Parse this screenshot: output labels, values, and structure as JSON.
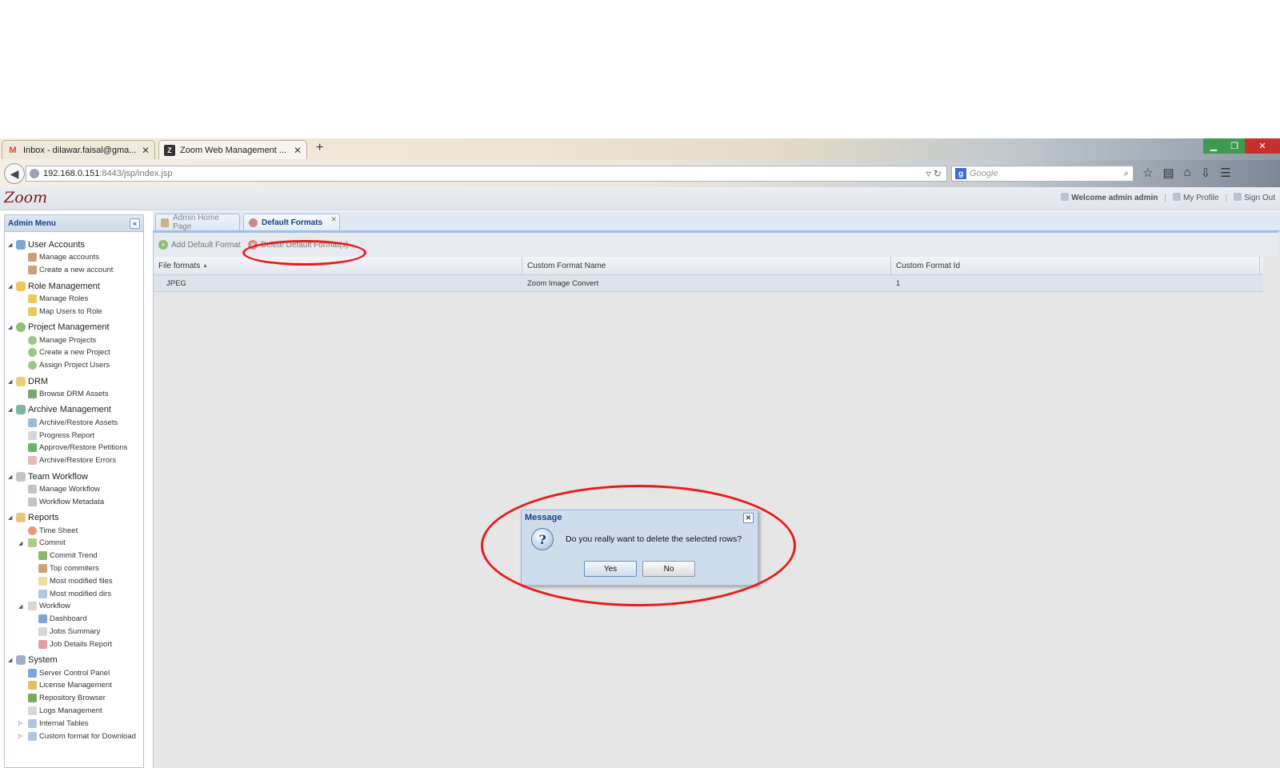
{
  "browser": {
    "tabs": [
      {
        "label": "Inbox - dilawar.faisal@gma...",
        "icon": "gmail-icon"
      },
      {
        "label": "Zoom Web Management ...",
        "icon": "zoom-icon"
      }
    ],
    "new_tab": "+",
    "url_host": "192.168.0.151",
    "url_rest": ":8443/jsp/index.jsp",
    "search_placeholder": "Google"
  },
  "app": {
    "logo": "Zoom",
    "welcome": "Welcome admin admin",
    "my_profile": "My Profile",
    "sign_out": "Sign Out"
  },
  "sidebar": {
    "title": "Admin Menu",
    "groups": [
      {
        "label": "User Accounts",
        "items": [
          "Manage accounts",
          "Create a new account"
        ]
      },
      {
        "label": "Role Management",
        "items": [
          "Manage Roles",
          "Map Users to Role"
        ]
      },
      {
        "label": "Project Management",
        "items": [
          "Manage Projects",
          "Create a new Project",
          "Assign Project Users"
        ]
      },
      {
        "label": "DRM",
        "items": [
          "Browse DRM Assets"
        ]
      },
      {
        "label": "Archive Management",
        "items": [
          "Archive/Restore Assets",
          "Progress Report",
          "Approve/Restore Petitions",
          "Archive/Restore Errors"
        ]
      },
      {
        "label": "Team Workflow",
        "items": [
          "Manage Workflow",
          "Workflow Metadata"
        ]
      },
      {
        "label": "Reports",
        "items": [
          "Time Sheet"
        ],
        "sub": [
          {
            "label": "Commit",
            "items": [
              "Commit Trend",
              "Top commiters",
              "Most modified files",
              "Most modified dirs"
            ]
          },
          {
            "label": "Workflow",
            "items": [
              "Dashboard",
              "Jobs Summary",
              "Job Details Report"
            ]
          }
        ]
      },
      {
        "label": "System",
        "items": [
          "Server Control Panel",
          "License Management",
          "Repository Browser",
          "Logs Management",
          "Internal Tables",
          "Custom format for Download"
        ]
      }
    ]
  },
  "main": {
    "tabs": [
      "Admin Home Page",
      "Default Formats"
    ],
    "toolbar": {
      "add": "Add Default Format",
      "delete": "Delete Default Format(s)"
    },
    "grid": {
      "columns": [
        "File formats",
        "Custom Format Name",
        "Custom Format Id"
      ],
      "rows": [
        [
          "JPEG",
          "Zoom Image Convert",
          "1"
        ]
      ]
    }
  },
  "dialog": {
    "title": "Message",
    "message": "Do you really want to delete the selected rows?",
    "yes": "Yes",
    "no": "No"
  },
  "colors": {
    "annotation": "#e81b1b",
    "accent": "#15428b"
  }
}
